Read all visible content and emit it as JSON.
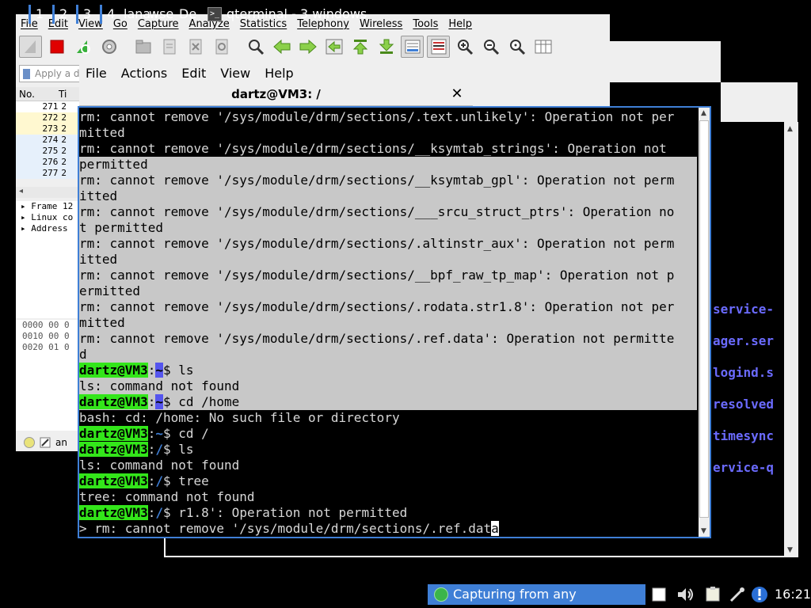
{
  "wireshark": {
    "menu": [
      "File",
      "Edit",
      "View",
      "Go",
      "Capture",
      "Analyze",
      "Statistics",
      "Telephony",
      "Wireless",
      "Tools",
      "Help"
    ],
    "filter_placeholder": "Apply a d",
    "columns": [
      "No.",
      "Ti"
    ],
    "rows": [
      {
        "no": "271",
        "t": "2",
        "bg": "#ffffff"
      },
      {
        "no": "272",
        "t": "2",
        "bg": "#fff8d0"
      },
      {
        "no": "273",
        "t": "2",
        "bg": "#fff8d0"
      },
      {
        "no": "274",
        "t": "2",
        "bg": "#e6f0fb"
      },
      {
        "no": "275",
        "t": "2",
        "bg": "#e6f0fb"
      },
      {
        "no": "276",
        "t": "2",
        "bg": "#e6f0fb"
      },
      {
        "no": "277",
        "t": "2",
        "bg": "#e6f0fb"
      }
    ],
    "tree": [
      "▸ Frame 12",
      "▸ Linux co",
      "▸ Address"
    ],
    "hex": [
      "0000  00 0",
      "0010  00 0",
      "0020  01 0"
    ],
    "status_text": "an"
  },
  "qterminal": {
    "menu": [
      "File",
      "Actions",
      "Edit",
      "View",
      "Help"
    ],
    "title": "dartz@VM3: /",
    "lines": [
      {
        "t": "rm: cannot remove '/sys/module/drm/sections/.text.unlikely': Operation not per",
        "sel": false
      },
      {
        "t": "mitted",
        "sel": false
      },
      {
        "t": "rm: cannot remove '/sys/module/drm/sections/__ksymtab_strings': Operation not ",
        "sel": false
      },
      {
        "t": "permitted",
        "sel": true
      },
      {
        "t": "rm: cannot remove '/sys/module/drm/sections/__ksymtab_gpl': Operation not perm",
        "sel": true
      },
      {
        "t": "itted",
        "sel": true
      },
      {
        "t": "rm: cannot remove '/sys/module/drm/sections/___srcu_struct_ptrs': Operation no",
        "sel": true
      },
      {
        "t": "t permitted",
        "sel": true
      },
      {
        "t": "rm: cannot remove '/sys/module/drm/sections/.altinstr_aux': Operation not perm",
        "sel": true
      },
      {
        "t": "itted",
        "sel": true
      },
      {
        "t": "rm: cannot remove '/sys/module/drm/sections/__bpf_raw_tp_map': Operation not p",
        "sel": true
      },
      {
        "t": "ermitted",
        "sel": true
      },
      {
        "t": "rm: cannot remove '/sys/module/drm/sections/.rodata.str1.8': Operation not per",
        "sel": true
      },
      {
        "t": "mitted",
        "sel": true
      },
      {
        "t": "rm: cannot remove '/sys/module/drm/sections/.ref.data': Operation not permitte",
        "sel": true
      },
      {
        "t": "d",
        "sel": true
      },
      {
        "prompt": "dartz@VM3",
        "path": "~",
        "cmd": "$ ls",
        "sel": true
      },
      {
        "t": "ls: command not found",
        "sel": true
      },
      {
        "prompt": "dartz@VM3",
        "path": "~",
        "cmd": "$ cd /home",
        "sel": true
      },
      {
        "t": "bash: cd: /home: No such file or directory",
        "sel": false
      },
      {
        "prompt": "dartz@VM3",
        "path": "~",
        "cmd": "$ cd /",
        "sel": false
      },
      {
        "prompt": "dartz@VM3",
        "path": "/",
        "cmd": "$ ls",
        "sel": false
      },
      {
        "t": "ls: command not found",
        "sel": false
      },
      {
        "prompt": "dartz@VM3",
        "path": "/",
        "cmd": "$ tree",
        "sel": false
      },
      {
        "t": "tree: command not found",
        "sel": false
      },
      {
        "prompt": "dartz@VM3",
        "path": "/",
        "cmd": "$ r1.8': Operation not permitted",
        "sel": false
      },
      {
        "t": "> rm: cannot remove '/sys/module/drm/sections/.ref.dat",
        "sel": false,
        "cursor": true
      }
    ]
  },
  "right_terminal": {
    "lines": [
      "service-",
      "ager.ser",
      "logind.s",
      "resolved",
      "timesync",
      "ervice-q"
    ]
  },
  "taskbar": {
    "desktops": [
      "1",
      "2",
      "3",
      "4"
    ],
    "apps": [
      {
        "label": "lana",
        "icon": ""
      },
      {
        "label": "wse",
        "icon": ""
      },
      {
        "label": "De",
        "icon": ""
      },
      {
        "label": "qterminal - 3 windows",
        "icon": ">_"
      }
    ],
    "active_app": "Capturing from any",
    "clock": "16:21"
  },
  "colors": {
    "accent": "#3f7fd6",
    "prompt_green": "#33e61a",
    "selection": "#c8c8c8",
    "terminal_bg": "#000000"
  }
}
